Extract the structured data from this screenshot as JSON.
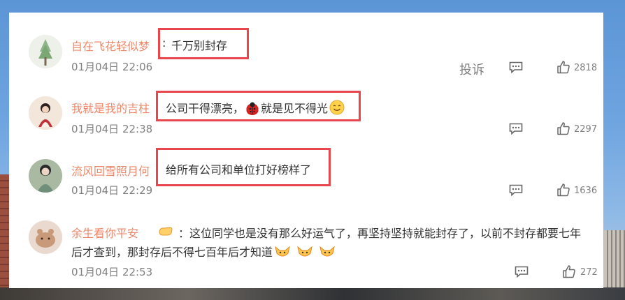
{
  "comments": [
    {
      "username": "自在飞花轻似梦",
      "text": "千万别封存",
      "time": "01月04日 22:06",
      "report": "投诉",
      "likes": "2818"
    },
    {
      "username": "我就是我的吉柱",
      "text": "公司干得漂亮，",
      "text_after": "就是见不得光",
      "time": "01月04日 22:38",
      "likes": "2297"
    },
    {
      "username": "流风回雪照月何",
      "text": "给所有公司和单位打好榜样了",
      "time": "01月04日 22:29",
      "likes": "1636"
    },
    {
      "username": "余生看你平安",
      "text_line1": "：这位同学也是没有那么好运气了，再坚持坚持就能封存了，以前不封存都要七年",
      "text_line2": "后才查到，那封存后不得七百年后才知道",
      "time": "01月04日 22:53",
      "likes": "272"
    }
  ],
  "colors": {
    "highlight": "#e8454c",
    "username": "#eb7350",
    "meta": "#808080"
  }
}
